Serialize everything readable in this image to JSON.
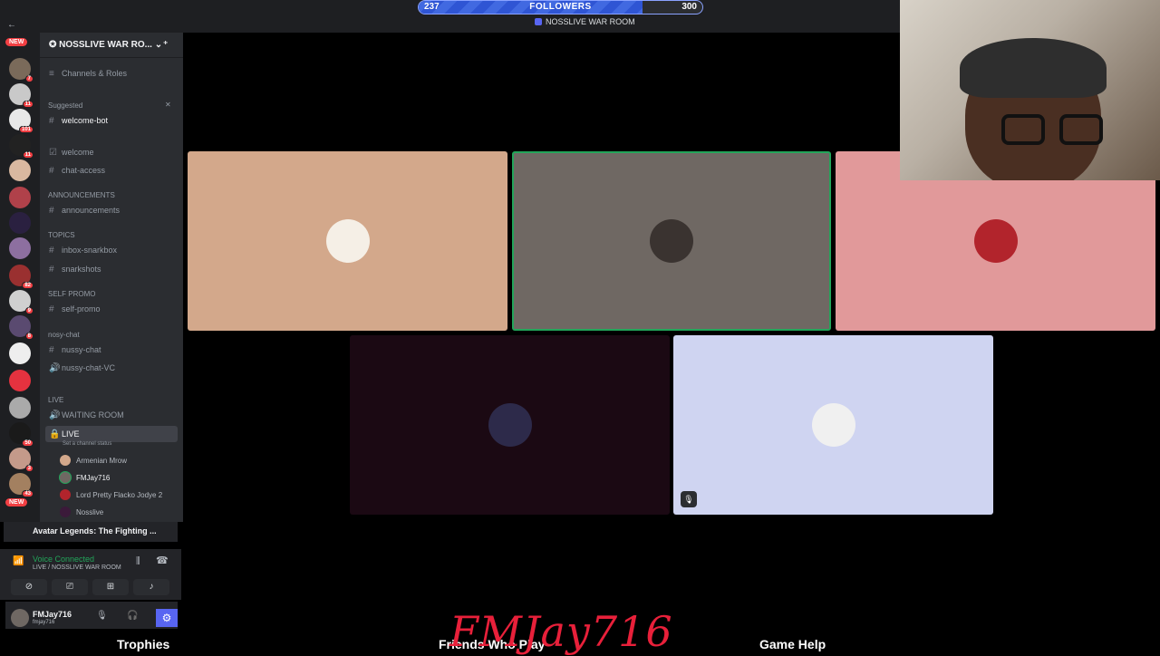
{
  "followers_goal": {
    "current": "237",
    "label": "FOLLOWERS",
    "target": "300",
    "progress": 0.79
  },
  "voice_channel_title": "NOSSLIVE WAR ROOM",
  "rail": {
    "badges": [
      "7",
      "11",
      "101",
      "11",
      "82",
      "9",
      "8",
      "50",
      "3",
      "43"
    ],
    "new_label": "NEW"
  },
  "server": {
    "name": "NOSSLIVE WAR RO...",
    "channels_roles": "Channels & Roles",
    "suggested": "Suggested",
    "channels": {
      "welcome_bot": "welcome-bot",
      "welcome": "welcome",
      "chat_access": "chat-access",
      "cat_announcements": "ANNOUNCEMENTS",
      "announcements": "announcements",
      "cat_topics": "TOPICS",
      "inbox": "inbox-snarkbox",
      "snarkshots": "snarkshots",
      "cat_selfpromo": "SELF PROMO",
      "self_promo": "self-promo",
      "cat_nosy": "nosy-chat",
      "nussy_chat": "nussy-chat",
      "nussy_vc": "nussy-chat-VC",
      "cat_live": "LIVE",
      "waiting_room": "WAITING ROOM",
      "live": "LIVE",
      "live_status": "Set a channel status"
    },
    "members": [
      "Armenian Mrow",
      "FMJay716",
      "Lord Pretty Flacko Jodye 2",
      "Nosslive"
    ]
  },
  "activity": {
    "game": "Avatar Legends: The Fighting ..."
  },
  "voice": {
    "status": "Voice Connected",
    "channel": "LIVE / NOSSLIVE WAR ROOM"
  },
  "user": {
    "name": "FMJay716",
    "tag": "fmjay716"
  },
  "game_ui": {
    "trophies": "Trophies",
    "friends": "Friends Who Play",
    "help": "Game Help"
  },
  "signature": "FMJay716",
  "colors": {
    "tile1": "#d3a88b",
    "tile2": "#6f6863",
    "tile3": "#e1999a",
    "tile4": "#1b0913",
    "tile5": "#cfd4f1",
    "speaking": "#23a55a",
    "accent": "#5865f2"
  }
}
